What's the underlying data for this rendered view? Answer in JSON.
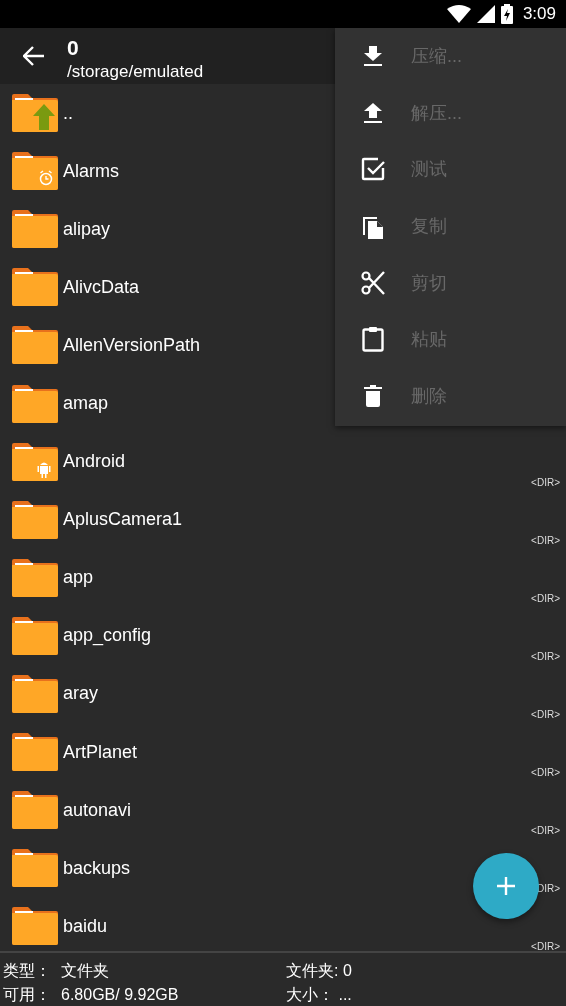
{
  "status_bar": {
    "time": "3:09"
  },
  "toolbar": {
    "title": "0",
    "path": "/storage/emulated"
  },
  "files": [
    {
      "name": "..",
      "kind": "up"
    },
    {
      "name": "Alarms",
      "kind": "alarm"
    },
    {
      "name": "alipay",
      "kind": "plain"
    },
    {
      "name": "AlivcData",
      "kind": "plain"
    },
    {
      "name": "AllenVersionPath",
      "kind": "plain"
    },
    {
      "name": "amap",
      "kind": "plain"
    },
    {
      "name": "Android",
      "kind": "android",
      "tag": "<DIR>"
    },
    {
      "name": "AplusCamera1",
      "kind": "plain",
      "tag": "<DIR>"
    },
    {
      "name": "app",
      "kind": "plain",
      "tag": "<DIR>"
    },
    {
      "name": "app_config",
      "kind": "plain",
      "tag": "<DIR>"
    },
    {
      "name": "aray",
      "kind": "plain",
      "tag": "<DIR>"
    },
    {
      "name": "ArtPlanet",
      "kind": "plain",
      "tag": "<DIR>"
    },
    {
      "name": "autonavi",
      "kind": "plain",
      "tag": "<DIR>"
    },
    {
      "name": "backups",
      "kind": "plain",
      "tag": "DIR>"
    },
    {
      "name": "baidu",
      "kind": "plain",
      "tag": "<DIR>"
    }
  ],
  "menu": [
    {
      "kind": "download",
      "label": "压缩...",
      "disabled": true
    },
    {
      "kind": "upload",
      "label": "解压...",
      "disabled": true
    },
    {
      "kind": "check",
      "label": "测试",
      "disabled": true
    },
    {
      "kind": "copy",
      "label": "复制",
      "disabled": true
    },
    {
      "kind": "cut",
      "label": "剪切",
      "disabled": true
    },
    {
      "kind": "paste",
      "label": "粘贴",
      "disabled": true
    },
    {
      "kind": "delete",
      "label": "删除",
      "disabled": true
    }
  ],
  "footer": [
    {
      "label": "类型：",
      "value": "文件夹"
    },
    {
      "label": "文件夹: 0"
    },
    {
      "label": "可用：",
      "value": "6.80GB/ 9.92GB"
    },
    {
      "label": "大小： ..."
    }
  ]
}
